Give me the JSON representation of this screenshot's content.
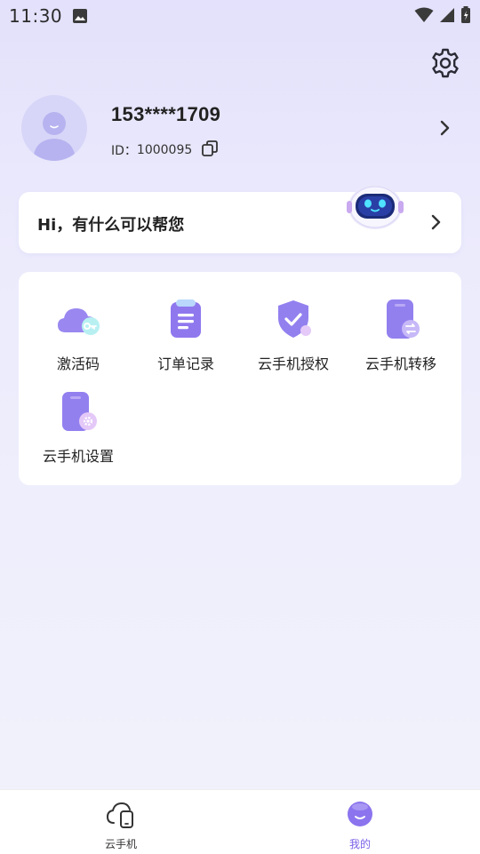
{
  "status_bar": {
    "time": "11:30"
  },
  "profile": {
    "phone": "153****1709",
    "id_label": "ID：",
    "id_value": "1000095"
  },
  "help": {
    "text": "Hi，有什么可以帮您"
  },
  "services": [
    {
      "label": "激活码",
      "icon": "cloud-key-icon"
    },
    {
      "label": "订单记录",
      "icon": "order-clipboard-icon"
    },
    {
      "label": "云手机授权",
      "icon": "shield-check-icon"
    },
    {
      "label": "云手机转移",
      "icon": "phone-transfer-icon"
    },
    {
      "label": "云手机设置",
      "icon": "phone-settings-icon"
    }
  ],
  "bottom_nav": {
    "items": [
      {
        "label": "云手机",
        "icon": "cloud-phone-icon",
        "active": false
      },
      {
        "label": "我的",
        "icon": "mine-smile-icon",
        "active": true
      }
    ]
  },
  "colors": {
    "accent": "#8b78ee",
    "active_nav": "#7b61e8",
    "inactive_nav": "#333333"
  }
}
